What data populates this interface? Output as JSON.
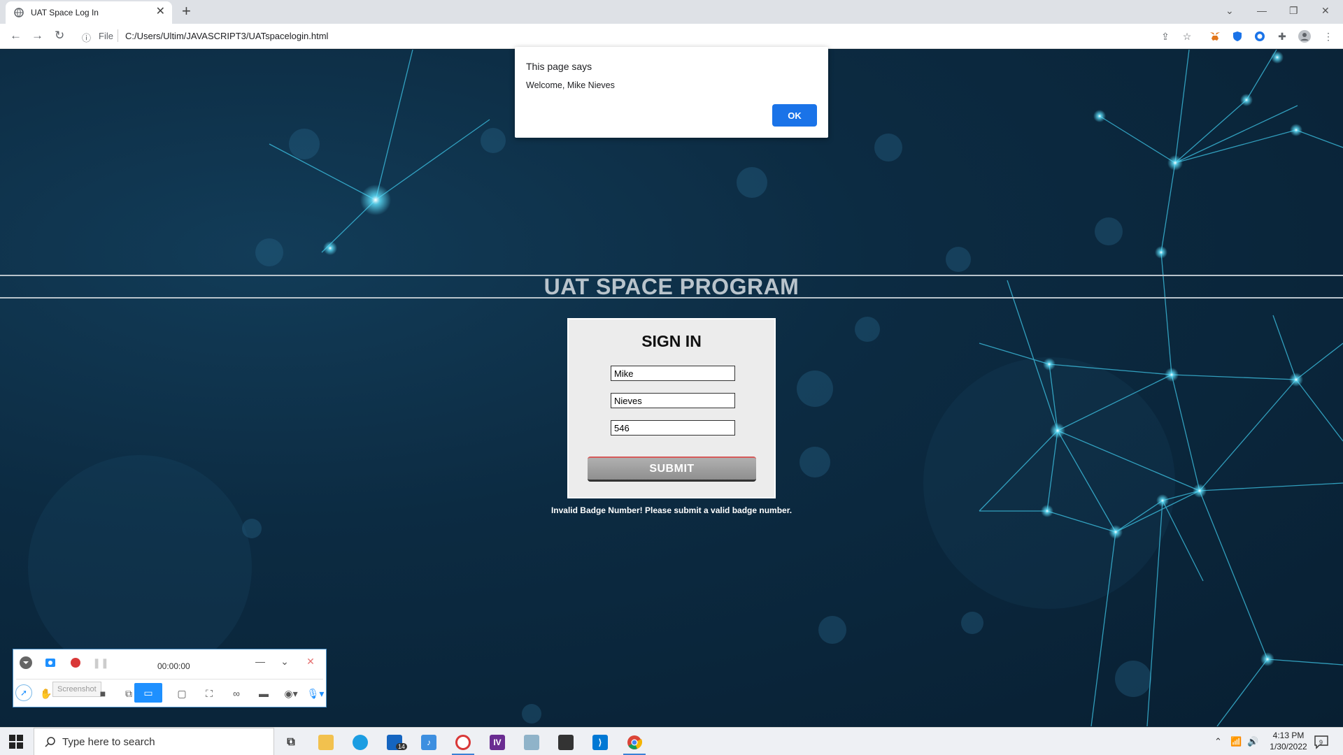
{
  "browser": {
    "tab_title": "UAT Space Log In",
    "new_tab": "+",
    "url_scheme": "File",
    "url": "C:/Users/Ultim/JAVASCRIPT3/UATspacelogin.html"
  },
  "page": {
    "banner_title": "UAT SPACE PROGRAM",
    "signin_title": "SIGN IN",
    "first_name_value": "Mike",
    "last_name_value": "Nieves",
    "badge_value": "546",
    "submit_label": "SUBMIT",
    "error_message": "Invalid Badge Number! Please submit a valid badge number."
  },
  "dialog": {
    "title": "This page says",
    "message": "Welcome, Mike Nieves",
    "ok_label": "OK"
  },
  "recorder": {
    "timer": "00:00:00",
    "tooltip": "Screenshot"
  },
  "taskbar": {
    "search_placeholder": "Type here to search",
    "mail_badge": "14",
    "time": "4:13 PM",
    "date": "1/30/2022",
    "notification_count": "9"
  },
  "colors": {
    "accent": "#1a73e8",
    "page_bg": "#0b2538",
    "node": "#5fe3ff"
  }
}
